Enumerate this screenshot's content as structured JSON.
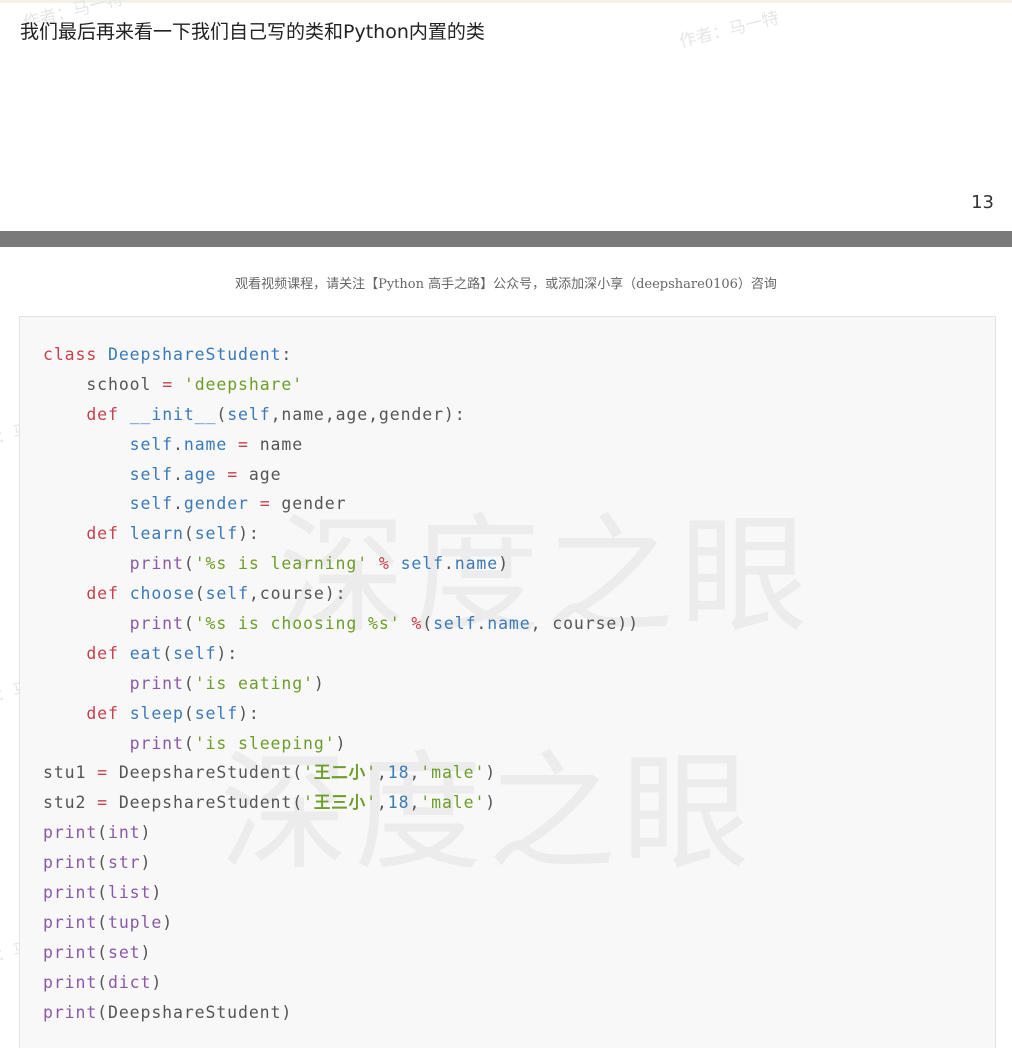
{
  "slide": {
    "heading": "我们最后再来看一下我们自己写的类和Python内置的类",
    "page_number": "13"
  },
  "notice": "观看视频课程，请关注【Python 高手之路】公众号，或添加深小享（deepshare0106）咨询",
  "watermarks": {
    "author": "作者：马一特",
    "brand": "深度之眼"
  },
  "code": {
    "language": "python",
    "lines": [
      {
        "indent": 0,
        "tokens": [
          {
            "t": "kw",
            "v": "class"
          },
          {
            "t": "plain",
            "v": " "
          },
          {
            "t": "fn",
            "v": "DeepshareStudent"
          },
          {
            "t": "plain",
            "v": ":"
          }
        ]
      },
      {
        "indent": 1,
        "tokens": [
          {
            "t": "plain",
            "v": "school "
          },
          {
            "t": "op",
            "v": "="
          },
          {
            "t": "plain",
            "v": " "
          },
          {
            "t": "str",
            "v": "'deepshare'"
          }
        ]
      },
      {
        "indent": 1,
        "tokens": [
          {
            "t": "def",
            "v": "def"
          },
          {
            "t": "plain",
            "v": " "
          },
          {
            "t": "fn",
            "v": "__init__"
          },
          {
            "t": "plain",
            "v": "("
          },
          {
            "t": "self",
            "v": "self"
          },
          {
            "t": "plain",
            "v": ",name,age,gender):"
          }
        ]
      },
      {
        "indent": 2,
        "tokens": [
          {
            "t": "self",
            "v": "self"
          },
          {
            "t": "plain",
            "v": "."
          },
          {
            "t": "attr",
            "v": "name"
          },
          {
            "t": "plain",
            "v": " "
          },
          {
            "t": "op",
            "v": "="
          },
          {
            "t": "plain",
            "v": " name"
          }
        ]
      },
      {
        "indent": 2,
        "tokens": [
          {
            "t": "self",
            "v": "self"
          },
          {
            "t": "plain",
            "v": "."
          },
          {
            "t": "attr",
            "v": "age"
          },
          {
            "t": "plain",
            "v": " "
          },
          {
            "t": "op",
            "v": "="
          },
          {
            "t": "plain",
            "v": " age"
          }
        ]
      },
      {
        "indent": 2,
        "tokens": [
          {
            "t": "self",
            "v": "self"
          },
          {
            "t": "plain",
            "v": "."
          },
          {
            "t": "attr",
            "v": "gender"
          },
          {
            "t": "plain",
            "v": " "
          },
          {
            "t": "op",
            "v": "="
          },
          {
            "t": "plain",
            "v": " gender"
          }
        ]
      },
      {
        "indent": 1,
        "tokens": [
          {
            "t": "def",
            "v": "def"
          },
          {
            "t": "plain",
            "v": " "
          },
          {
            "t": "fn",
            "v": "learn"
          },
          {
            "t": "plain",
            "v": "("
          },
          {
            "t": "self",
            "v": "self"
          },
          {
            "t": "plain",
            "v": "):"
          }
        ]
      },
      {
        "indent": 2,
        "tokens": [
          {
            "t": "builtin",
            "v": "print"
          },
          {
            "t": "plain",
            "v": "("
          },
          {
            "t": "str",
            "v": "'%s is learning'"
          },
          {
            "t": "plain",
            "v": " "
          },
          {
            "t": "op",
            "v": "%"
          },
          {
            "t": "plain",
            "v": " "
          },
          {
            "t": "self",
            "v": "self"
          },
          {
            "t": "plain",
            "v": "."
          },
          {
            "t": "attr",
            "v": "name"
          },
          {
            "t": "plain",
            "v": ")"
          }
        ]
      },
      {
        "indent": 1,
        "tokens": [
          {
            "t": "def",
            "v": "def"
          },
          {
            "t": "plain",
            "v": " "
          },
          {
            "t": "fn",
            "v": "choose"
          },
          {
            "t": "plain",
            "v": "("
          },
          {
            "t": "self",
            "v": "self"
          },
          {
            "t": "plain",
            "v": ",course):"
          }
        ]
      },
      {
        "indent": 2,
        "tokens": [
          {
            "t": "builtin",
            "v": "print"
          },
          {
            "t": "plain",
            "v": "("
          },
          {
            "t": "str",
            "v": "'%s is choosing %s'"
          },
          {
            "t": "plain",
            "v": " "
          },
          {
            "t": "op",
            "v": "%"
          },
          {
            "t": "plain",
            "v": "("
          },
          {
            "t": "self",
            "v": "self"
          },
          {
            "t": "plain",
            "v": "."
          },
          {
            "t": "attr",
            "v": "name"
          },
          {
            "t": "plain",
            "v": ", course))"
          }
        ]
      },
      {
        "indent": 1,
        "tokens": [
          {
            "t": "def",
            "v": "def"
          },
          {
            "t": "plain",
            "v": " "
          },
          {
            "t": "fn",
            "v": "eat"
          },
          {
            "t": "plain",
            "v": "("
          },
          {
            "t": "self",
            "v": "self"
          },
          {
            "t": "plain",
            "v": "):"
          }
        ]
      },
      {
        "indent": 2,
        "tokens": [
          {
            "t": "builtin",
            "v": "print"
          },
          {
            "t": "plain",
            "v": "("
          },
          {
            "t": "str",
            "v": "'is eating'"
          },
          {
            "t": "plain",
            "v": ")"
          }
        ]
      },
      {
        "indent": 1,
        "tokens": [
          {
            "t": "def",
            "v": "def"
          },
          {
            "t": "plain",
            "v": " "
          },
          {
            "t": "fn",
            "v": "sleep"
          },
          {
            "t": "plain",
            "v": "("
          },
          {
            "t": "self",
            "v": "self"
          },
          {
            "t": "plain",
            "v": "):"
          }
        ]
      },
      {
        "indent": 2,
        "tokens": [
          {
            "t": "builtin",
            "v": "print"
          },
          {
            "t": "plain",
            "v": "("
          },
          {
            "t": "str",
            "v": "'is sleeping'"
          },
          {
            "t": "plain",
            "v": ")"
          }
        ]
      },
      {
        "indent": 0,
        "tokens": [
          {
            "t": "plain",
            "v": "stu1 "
          },
          {
            "t": "op",
            "v": "="
          },
          {
            "t": "plain",
            "v": " DeepshareStudent("
          },
          {
            "t": "str",
            "v": "'"
          },
          {
            "t": "cjk",
            "v": "王二小"
          },
          {
            "t": "str",
            "v": "'"
          },
          {
            "t": "plain",
            "v": ","
          },
          {
            "t": "num",
            "v": "18"
          },
          {
            "t": "plain",
            "v": ","
          },
          {
            "t": "str",
            "v": "'male'"
          },
          {
            "t": "plain",
            "v": ")"
          }
        ]
      },
      {
        "indent": 0,
        "tokens": [
          {
            "t": "plain",
            "v": "stu2 "
          },
          {
            "t": "op",
            "v": "="
          },
          {
            "t": "plain",
            "v": " DeepshareStudent("
          },
          {
            "t": "str",
            "v": "'"
          },
          {
            "t": "cjk",
            "v": "王三小"
          },
          {
            "t": "str",
            "v": "'"
          },
          {
            "t": "plain",
            "v": ","
          },
          {
            "t": "num",
            "v": "18"
          },
          {
            "t": "plain",
            "v": ","
          },
          {
            "t": "str",
            "v": "'male'"
          },
          {
            "t": "plain",
            "v": ")"
          }
        ]
      },
      {
        "indent": 0,
        "tokens": [
          {
            "t": "builtin",
            "v": "print"
          },
          {
            "t": "plain",
            "v": "("
          },
          {
            "t": "builtin",
            "v": "int"
          },
          {
            "t": "plain",
            "v": ")"
          }
        ]
      },
      {
        "indent": 0,
        "tokens": [
          {
            "t": "builtin",
            "v": "print"
          },
          {
            "t": "plain",
            "v": "("
          },
          {
            "t": "builtin",
            "v": "str"
          },
          {
            "t": "plain",
            "v": ")"
          }
        ]
      },
      {
        "indent": 0,
        "tokens": [
          {
            "t": "builtin",
            "v": "print"
          },
          {
            "t": "plain",
            "v": "("
          },
          {
            "t": "builtin",
            "v": "list"
          },
          {
            "t": "plain",
            "v": ")"
          }
        ]
      },
      {
        "indent": 0,
        "tokens": [
          {
            "t": "builtin",
            "v": "print"
          },
          {
            "t": "plain",
            "v": "("
          },
          {
            "t": "builtin",
            "v": "tuple"
          },
          {
            "t": "plain",
            "v": ")"
          }
        ]
      },
      {
        "indent": 0,
        "tokens": [
          {
            "t": "builtin",
            "v": "print"
          },
          {
            "t": "plain",
            "v": "("
          },
          {
            "t": "builtin",
            "v": "set"
          },
          {
            "t": "plain",
            "v": ")"
          }
        ]
      },
      {
        "indent": 0,
        "tokens": [
          {
            "t": "builtin",
            "v": "print"
          },
          {
            "t": "plain",
            "v": "("
          },
          {
            "t": "builtin",
            "v": "dict"
          },
          {
            "t": "plain",
            "v": ")"
          }
        ]
      },
      {
        "indent": 0,
        "tokens": [
          {
            "t": "builtin",
            "v": "print"
          },
          {
            "t": "plain",
            "v": "(DeepshareStudent)"
          }
        ]
      }
    ]
  }
}
